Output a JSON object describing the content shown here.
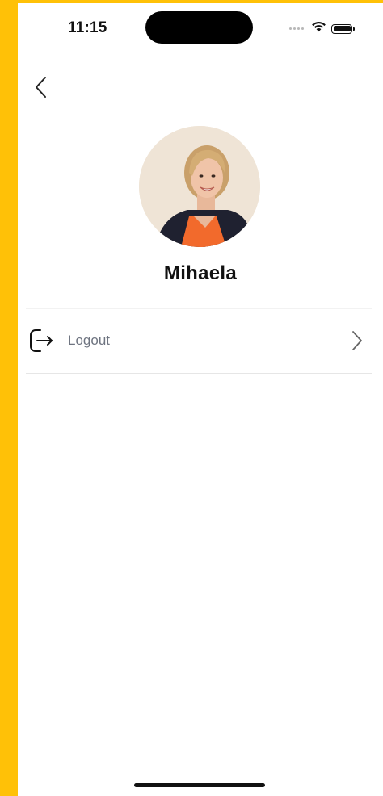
{
  "status_bar": {
    "time": "11:15"
  },
  "navigation": {
    "back_icon": "chevron-left-icon"
  },
  "profile": {
    "name": "Mihaela"
  },
  "menu": {
    "items": [
      {
        "label": "Logout",
        "icon": "logout-icon",
        "trailing_icon": "chevron-right-icon"
      }
    ]
  },
  "colors": {
    "background_accent": "#ffc107",
    "label_gray": "#6e7480",
    "avatar_shirt": "#f26a2c"
  }
}
